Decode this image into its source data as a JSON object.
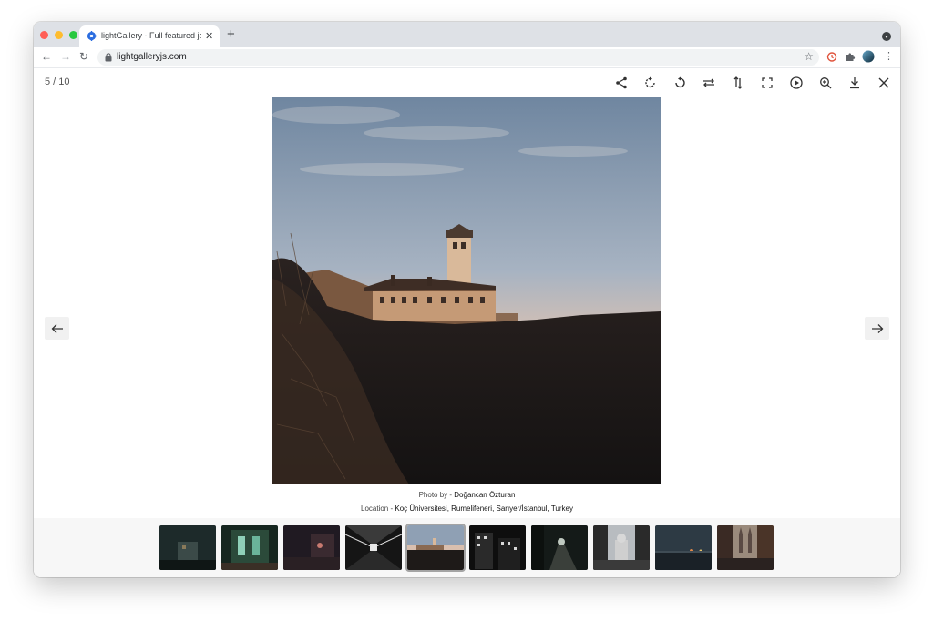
{
  "browser": {
    "tab_title": "lightGallery - Full featured javascript image & video gallery",
    "url": "lightgalleryjs.com",
    "traffic_lights": [
      "#ff5f57",
      "#febc2e",
      "#28c840"
    ]
  },
  "gallery": {
    "counter": "5 / 10",
    "toolbar_icons": [
      "share-icon",
      "rotate-right-icon",
      "rotate-left-icon",
      "flip-horizontal-icon",
      "flip-vertical-icon",
      "fullscreen-icon",
      "autoplay-icon",
      "zoom-in-icon",
      "download-icon",
      "close-icon"
    ],
    "caption": {
      "photo_prefix": "Photo by - ",
      "photographer": "Doğancan Özturan",
      "location_prefix": "Location - ",
      "location": "Koç Üniversitesi, Rumelifeneri, Sarıyer/İstanbul, Turkey"
    },
    "thumbnails": [
      {
        "name": "thumbnail-1",
        "active": false
      },
      {
        "name": "thumbnail-2",
        "active": false
      },
      {
        "name": "thumbnail-3",
        "active": false
      },
      {
        "name": "thumbnail-4",
        "active": false
      },
      {
        "name": "thumbnail-5",
        "active": true
      },
      {
        "name": "thumbnail-6",
        "active": false
      },
      {
        "name": "thumbnail-7",
        "active": false
      },
      {
        "name": "thumbnail-8",
        "active": false
      },
      {
        "name": "thumbnail-9",
        "active": false
      },
      {
        "name": "thumbnail-10",
        "active": false
      }
    ]
  }
}
